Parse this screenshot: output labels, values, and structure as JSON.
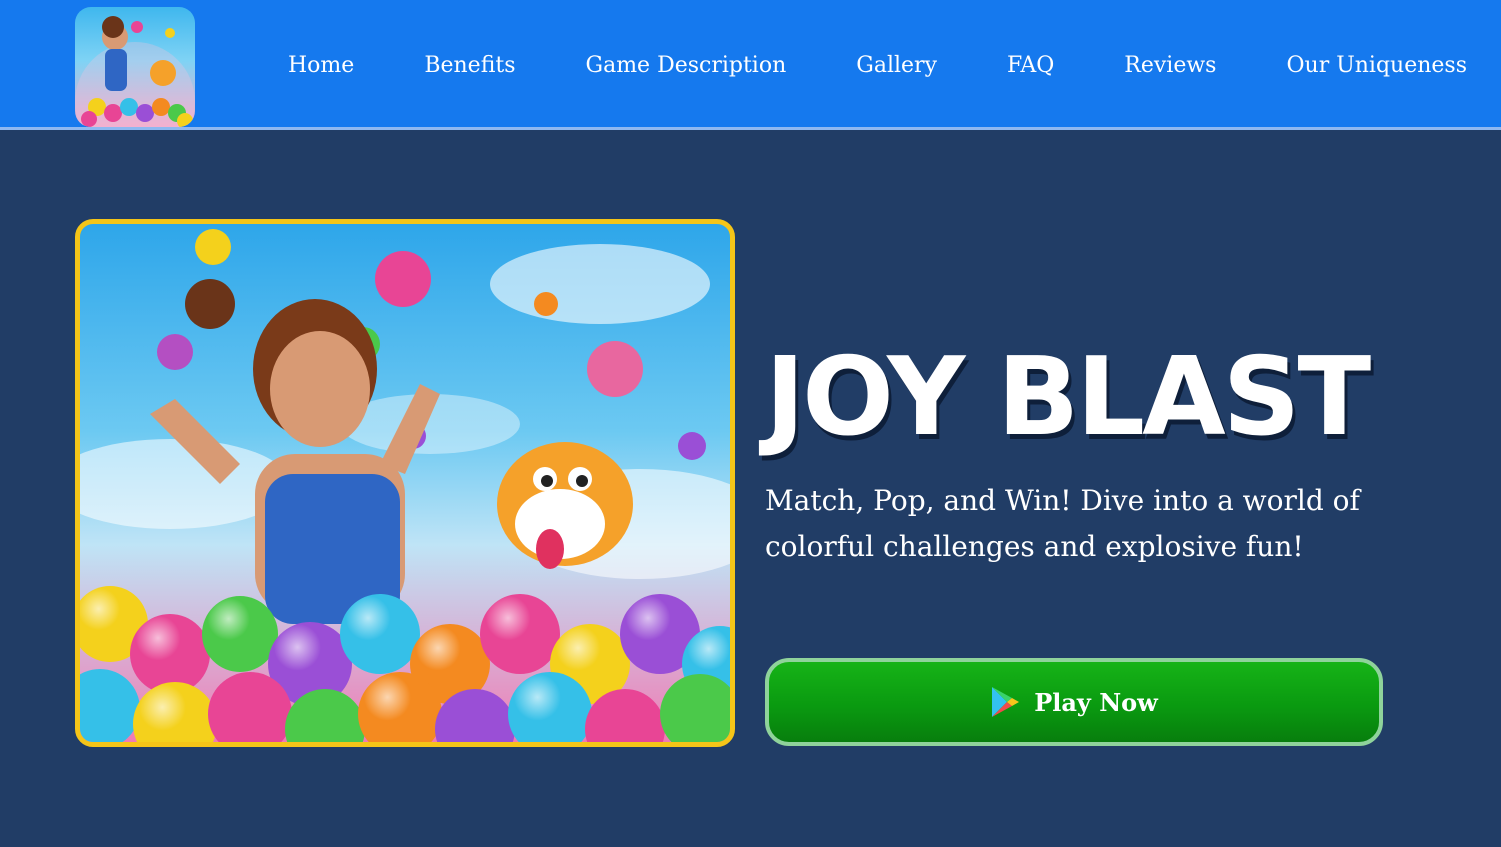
{
  "header": {
    "logo_icon": "joy-blast-app-icon",
    "nav": [
      {
        "label": "Home"
      },
      {
        "label": "Benefits"
      },
      {
        "label": "Game Description"
      },
      {
        "label": "Gallery"
      },
      {
        "label": "FAQ"
      },
      {
        "label": "Reviews"
      },
      {
        "label": "Our Uniqueness"
      }
    ]
  },
  "hero": {
    "image_icon": "game-hero-artwork",
    "title": "JOY BLAST",
    "tagline": "Match, Pop, and Win! Dive into a world of colorful challenges and explosive fun!",
    "play_button": {
      "label": "Play Now",
      "icon": "google-play-icon"
    }
  },
  "colors": {
    "header_bg": "#1579ee",
    "page_bg": "#213d66",
    "frame_border": "#f5c518",
    "button_green": "#0a9a10",
    "button_border": "#8fd39b"
  }
}
